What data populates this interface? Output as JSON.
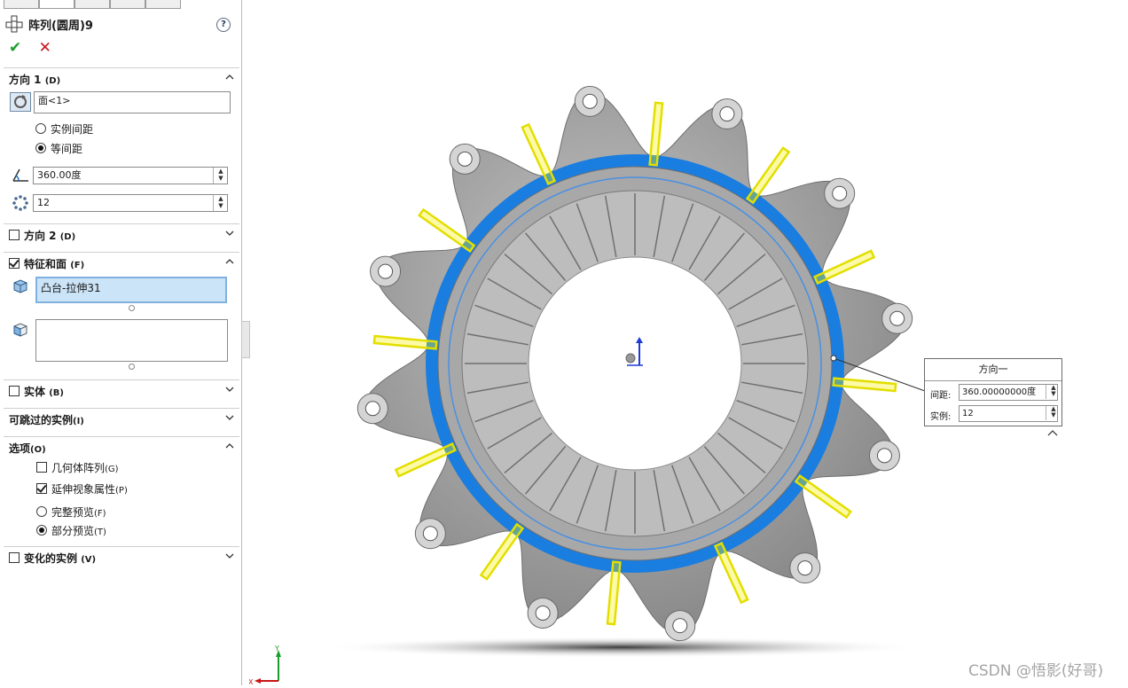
{
  "property_manager": {
    "title": "阵列(圆周)9",
    "help_glyph": "?",
    "ok_glyph": "✔",
    "cancel_glyph": "✕",
    "direction1": {
      "label": "方向 1",
      "key": "(D)",
      "reference": "面<1>",
      "spacing_options": [
        {
          "label": "实例间距",
          "selected": false
        },
        {
          "label": "等间距",
          "selected": true
        }
      ],
      "angle": "360.00度",
      "instances": "12"
    },
    "direction2": {
      "label": "方向 2",
      "key": "(D)",
      "checked": false
    },
    "features_faces": {
      "label": "特征和面",
      "key": "(F)",
      "checked": true,
      "features": [
        "凸台-拉伸31"
      ],
      "faces": []
    },
    "bodies": {
      "label": "实体",
      "key": "(B)",
      "checked": false
    },
    "skip_instances": {
      "label": "可跳过的实例",
      "key": "(I)"
    },
    "options": {
      "label": "选项",
      "key": "(O)",
      "geometry_pattern": {
        "label": "几何体阵列",
        "key": "(G)",
        "checked": false
      },
      "propagate_visual": {
        "label": "延伸视象属性",
        "key": "(P)",
        "checked": true
      },
      "full_preview": {
        "label": "完整预览",
        "key": "(F)",
        "selected": false
      },
      "partial_preview": {
        "label": "部分预览",
        "key": "(T)",
        "selected": true
      }
    },
    "varied_instances": {
      "label": "变化的实例",
      "key": "(V)",
      "checked": false
    }
  },
  "callout": {
    "title": "方向一",
    "spacing_label": "间距:",
    "spacing_value": "360.00000000度",
    "instances_label": "实例:",
    "instances_value": "12"
  },
  "triad": {
    "y_label": "Y",
    "x_label": "X"
  },
  "watermark": "CSDN @悟影(好哥)",
  "colors": {
    "highlight_blue": "#1a7de0",
    "preview_yellow": "#f5f000",
    "part_gray": "#9b9b9b",
    "selection_fill": "#cce4f7"
  }
}
